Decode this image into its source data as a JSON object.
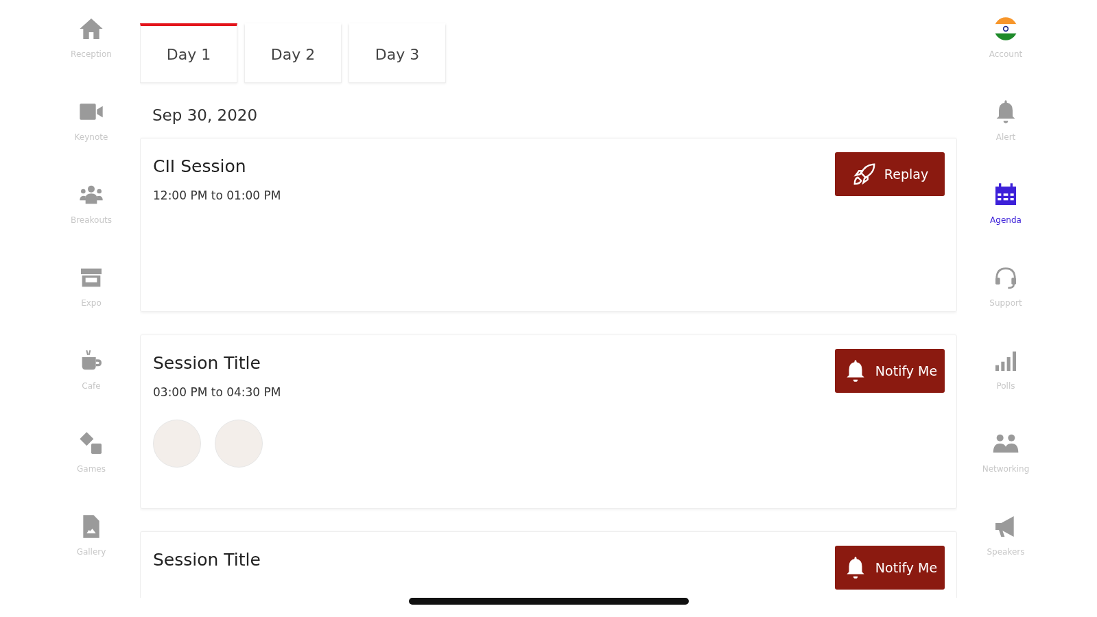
{
  "nav_left": [
    {
      "label": "Reception",
      "kind": "home",
      "selected": false
    },
    {
      "label": "Keynote",
      "kind": "video",
      "selected": false
    },
    {
      "label": "Breakouts",
      "kind": "group",
      "selected": false
    },
    {
      "label": "Expo",
      "kind": "store",
      "selected": false
    },
    {
      "label": "Cafe",
      "kind": "cup",
      "selected": false
    },
    {
      "label": "Games",
      "kind": "dice",
      "selected": false
    },
    {
      "label": "Gallery",
      "kind": "file",
      "selected": false
    }
  ],
  "tabs": [
    {
      "label": "Day 1",
      "selected": true
    },
    {
      "label": "Day 2",
      "selected": false
    },
    {
      "label": "Day 3",
      "selected": false
    }
  ],
  "date": "Sep 30, 2020",
  "sessions": [
    {
      "title": "CII Session",
      "time": "12:00 PM to 01:00 PM",
      "action": {
        "kind": "replay",
        "label": "Replay"
      }
    },
    {
      "title": "Session Title",
      "time": "03:00 PM to 04:30 PM",
      "action": {
        "kind": "notify",
        "label": "Notify Me"
      },
      "speakers": [
        {
          "kind": "logo"
        },
        {
          "kind": "logo"
        }
      ]
    },
    {
      "title": "Session Title",
      "action": {
        "kind": "notify",
        "label": "Notify Me"
      }
    }
  ],
  "nav_right": [
    {
      "label": "Account",
      "kind": "flag",
      "selected": false
    },
    {
      "label": "Alert",
      "kind": "bell",
      "selected": false
    },
    {
      "label": "Agenda",
      "kind": "calendar",
      "selected": true
    },
    {
      "label": "Support",
      "kind": "headset",
      "selected": false
    },
    {
      "label": "Polls",
      "kind": "bars",
      "selected": false
    },
    {
      "label": "Networking",
      "kind": "people",
      "selected": false
    },
    {
      "label": "Speakers",
      "kind": "megaphone",
      "selected": false
    }
  ]
}
